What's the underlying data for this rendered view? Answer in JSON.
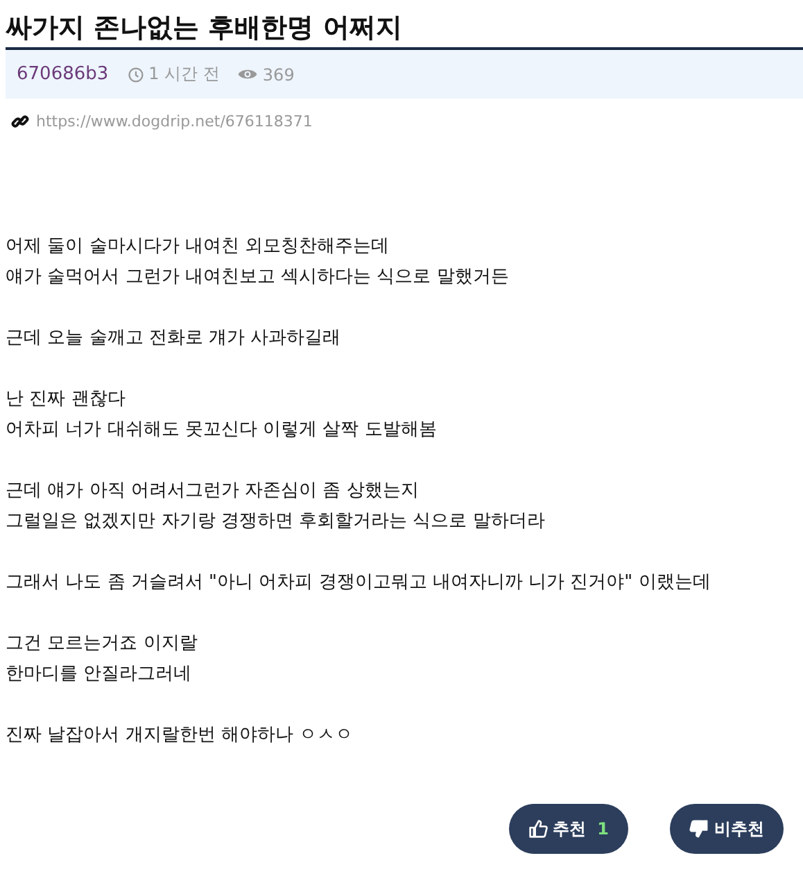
{
  "title": "싸가지 존나없는 후배한명 어쩌지",
  "meta": {
    "author": "670686b3",
    "time": "1 시간 전",
    "views": "369"
  },
  "link": "https://www.dogdrip.net/676118371",
  "paragraphs": [
    [
      "어제 둘이 술마시다가 내여친 외모칭찬해주는데",
      "얘가 술먹어서 그런가 내여친보고 섹시하다는 식으로 말했거든"
    ],
    [
      "근데 오늘 술깨고 전화로 걔가 사과하길래"
    ],
    [
      "난 진짜 괜찮다",
      "어차피 너가 대쉬해도 못꼬신다 이렇게 살짝 도발해봄"
    ],
    [
      "근데 얘가 아직 어려서그런가 자존심이 좀 상했는지",
      "그럴일은 없겠지만 자기랑 경쟁하면 후회할거라는 식으로 말하더라"
    ],
    [
      "그래서 나도 좀 거슬려서 \"아니 어차피 경쟁이고뭐고 내여자니까 니가 진거야\" 이랬는데"
    ],
    [
      "그건 모르는거죠 이지랄",
      "한마디를 안질라그러네"
    ],
    [
      "진짜 날잡아서 개지랄한번 해야하나 ㅇㅅㅇ"
    ]
  ],
  "buttons": [
    {
      "kind": "up",
      "label": "추천",
      "count": "1"
    },
    {
      "kind": "down",
      "label": "비추천"
    }
  ]
}
